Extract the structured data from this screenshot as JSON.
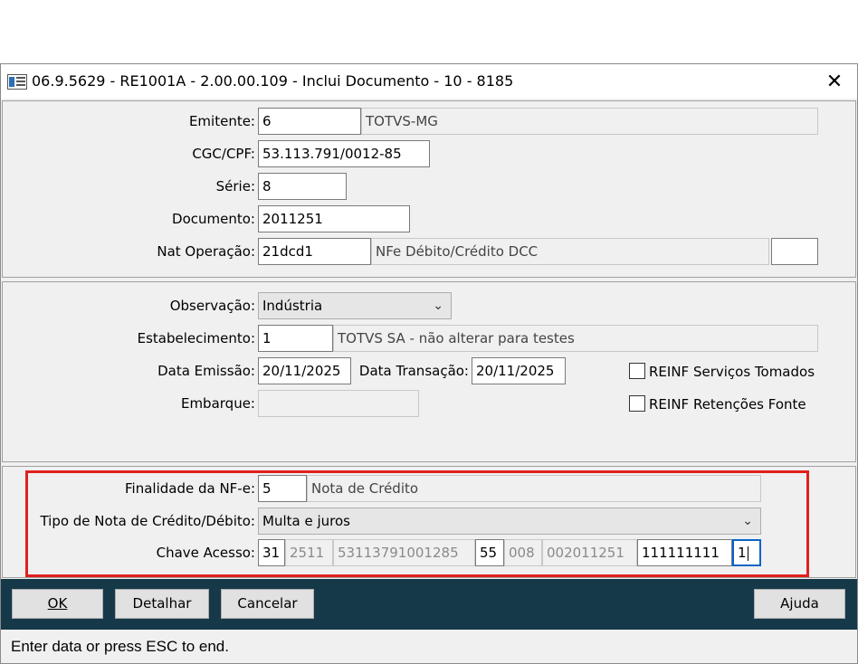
{
  "window": {
    "title": "06.9.5629 - RE1001A - 2.00.00.109 - Inclui Documento - 10 - 8185",
    "close_glyph": "✕"
  },
  "doc": {
    "emitente_label": "Emitente:",
    "emitente_code": "6",
    "emitente_name": "TOTVS-MG",
    "cgc_label": "CGC/CPF:",
    "cgc_value": "53.113.791/0012-85",
    "serie_label": "Série:",
    "serie_value": "8",
    "documento_label": "Documento:",
    "documento_value": "2011251",
    "natop_label": "Nat Operação:",
    "natop_code": "21dcd1",
    "natop_desc": "NFe Débito/Crédito DCC",
    "natop_extra": ""
  },
  "details": {
    "observacao_label": "Observação:",
    "observacao_value": "Indústria",
    "estab_label": "Estabelecimento:",
    "estab_code": "1",
    "estab_desc": "TOTVS SA - não alterar para testes",
    "data_emissao_label": "Data Emissão:",
    "data_emissao_value": "20/11/2025",
    "data_transacao_label": "Data Transação:",
    "data_transacao_value": "20/11/2025",
    "embarque_label": "Embarque:",
    "embarque_value": "",
    "reinf_servicos_label": "REINF Serviços Tomados",
    "reinf_retencoes_label": "REINF Retenções Fonte"
  },
  "nfe": {
    "finalidade_label": "Finalidade da NF-e:",
    "finalidade_code": "5",
    "finalidade_desc": "Nota de Crédito",
    "tipo_label": "Tipo de Nota de Crédito/Débito:",
    "tipo_value": "Multa e juros",
    "chave_label": "Chave Acesso:",
    "chave_uf": "31",
    "chave_aamm": "2511",
    "chave_cnpj": "53113791001285",
    "chave_modelo": "55",
    "chave_serie": "008",
    "chave_numero": "002011251",
    "chave_codigo": "111111111",
    "chave_dv": "1"
  },
  "buttons": {
    "ok": "OK",
    "detalhar": "Detalhar",
    "cancelar": "Cancelar",
    "ajuda": "Ajuda"
  },
  "status": {
    "message": "Enter data or press ESC to end."
  },
  "colors": {
    "highlight_border": "#e0201e",
    "button_bar": "#16394a",
    "focus_border": "#0a64c8"
  }
}
